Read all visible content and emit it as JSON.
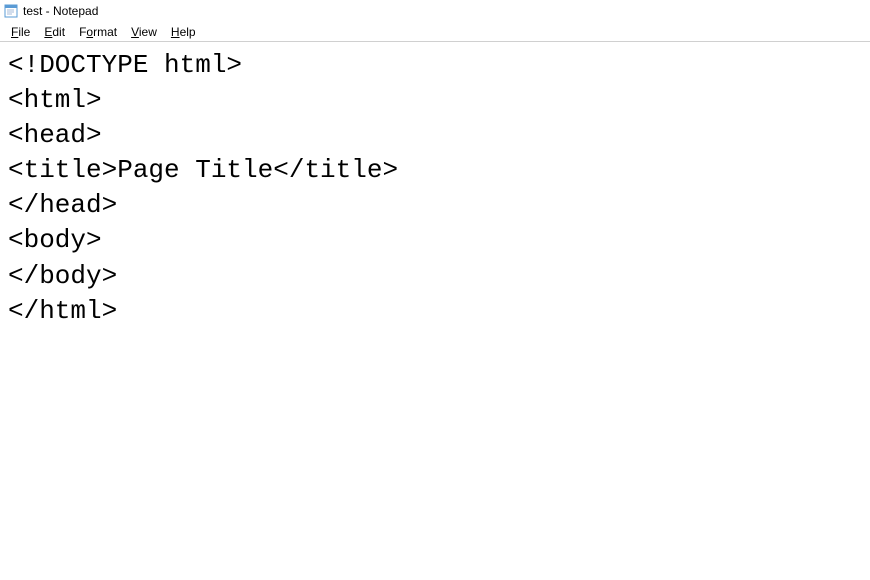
{
  "window": {
    "title": "test - Notepad"
  },
  "menu": {
    "file": "File",
    "edit": "Edit",
    "format": "Format",
    "view": "View",
    "help": "Help"
  },
  "editor": {
    "content": "<!DOCTYPE html>\n<html>\n<head>\n<title>Page Title</title>\n</head>\n<body>\n</body>\n</html>"
  }
}
